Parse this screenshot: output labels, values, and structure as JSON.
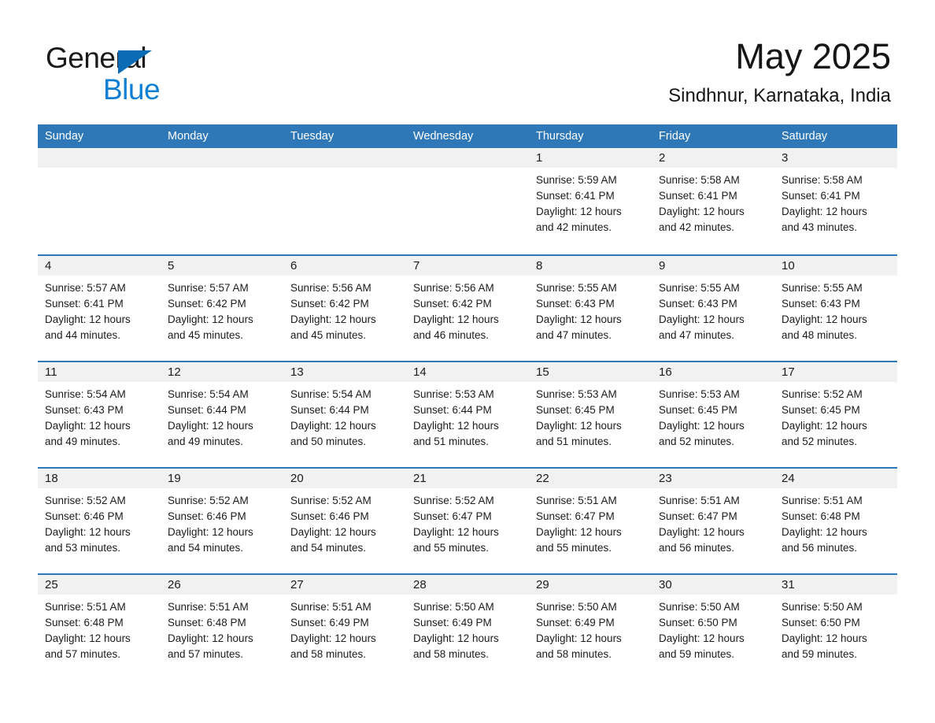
{
  "brand": {
    "name_part1": "General",
    "name_part2": "Blue",
    "triangle_icon": "triangle-icon",
    "accent_dark": "#0a6cb5",
    "accent_light": "#0f7fd4"
  },
  "header": {
    "month_title": "May 2025",
    "location": "Sindhnur, Karnataka, India"
  },
  "calendar": {
    "header_color": "#2f78b8",
    "day_band_color": "#f1f1f1",
    "weekdays": [
      "Sunday",
      "Monday",
      "Tuesday",
      "Wednesday",
      "Thursday",
      "Friday",
      "Saturday"
    ],
    "weeks": [
      [
        {
          "day": "",
          "empty": true,
          "sunrise": "",
          "sunset": "",
          "daylight_line1": "",
          "daylight_line2": ""
        },
        {
          "day": "",
          "empty": true,
          "sunrise": "",
          "sunset": "",
          "daylight_line1": "",
          "daylight_line2": ""
        },
        {
          "day": "",
          "empty": true,
          "sunrise": "",
          "sunset": "",
          "daylight_line1": "",
          "daylight_line2": ""
        },
        {
          "day": "",
          "empty": true,
          "sunrise": "",
          "sunset": "",
          "daylight_line1": "",
          "daylight_line2": ""
        },
        {
          "day": "1",
          "empty": false,
          "sunrise": "Sunrise: 5:59 AM",
          "sunset": "Sunset: 6:41 PM",
          "daylight_line1": "Daylight: 12 hours",
          "daylight_line2": "and 42 minutes."
        },
        {
          "day": "2",
          "empty": false,
          "sunrise": "Sunrise: 5:58 AM",
          "sunset": "Sunset: 6:41 PM",
          "daylight_line1": "Daylight: 12 hours",
          "daylight_line2": "and 42 minutes."
        },
        {
          "day": "3",
          "empty": false,
          "sunrise": "Sunrise: 5:58 AM",
          "sunset": "Sunset: 6:41 PM",
          "daylight_line1": "Daylight: 12 hours",
          "daylight_line2": "and 43 minutes."
        }
      ],
      [
        {
          "day": "4",
          "empty": false,
          "sunrise": "Sunrise: 5:57 AM",
          "sunset": "Sunset: 6:41 PM",
          "daylight_line1": "Daylight: 12 hours",
          "daylight_line2": "and 44 minutes."
        },
        {
          "day": "5",
          "empty": false,
          "sunrise": "Sunrise: 5:57 AM",
          "sunset": "Sunset: 6:42 PM",
          "daylight_line1": "Daylight: 12 hours",
          "daylight_line2": "and 45 minutes."
        },
        {
          "day": "6",
          "empty": false,
          "sunrise": "Sunrise: 5:56 AM",
          "sunset": "Sunset: 6:42 PM",
          "daylight_line1": "Daylight: 12 hours",
          "daylight_line2": "and 45 minutes."
        },
        {
          "day": "7",
          "empty": false,
          "sunrise": "Sunrise: 5:56 AM",
          "sunset": "Sunset: 6:42 PM",
          "daylight_line1": "Daylight: 12 hours",
          "daylight_line2": "and 46 minutes."
        },
        {
          "day": "8",
          "empty": false,
          "sunrise": "Sunrise: 5:55 AM",
          "sunset": "Sunset: 6:43 PM",
          "daylight_line1": "Daylight: 12 hours",
          "daylight_line2": "and 47 minutes."
        },
        {
          "day": "9",
          "empty": false,
          "sunrise": "Sunrise: 5:55 AM",
          "sunset": "Sunset: 6:43 PM",
          "daylight_line1": "Daylight: 12 hours",
          "daylight_line2": "and 47 minutes."
        },
        {
          "day": "10",
          "empty": false,
          "sunrise": "Sunrise: 5:55 AM",
          "sunset": "Sunset: 6:43 PM",
          "daylight_line1": "Daylight: 12 hours",
          "daylight_line2": "and 48 minutes."
        }
      ],
      [
        {
          "day": "11",
          "empty": false,
          "sunrise": "Sunrise: 5:54 AM",
          "sunset": "Sunset: 6:43 PM",
          "daylight_line1": "Daylight: 12 hours",
          "daylight_line2": "and 49 minutes."
        },
        {
          "day": "12",
          "empty": false,
          "sunrise": "Sunrise: 5:54 AM",
          "sunset": "Sunset: 6:44 PM",
          "daylight_line1": "Daylight: 12 hours",
          "daylight_line2": "and 49 minutes."
        },
        {
          "day": "13",
          "empty": false,
          "sunrise": "Sunrise: 5:54 AM",
          "sunset": "Sunset: 6:44 PM",
          "daylight_line1": "Daylight: 12 hours",
          "daylight_line2": "and 50 minutes."
        },
        {
          "day": "14",
          "empty": false,
          "sunrise": "Sunrise: 5:53 AM",
          "sunset": "Sunset: 6:44 PM",
          "daylight_line1": "Daylight: 12 hours",
          "daylight_line2": "and 51 minutes."
        },
        {
          "day": "15",
          "empty": false,
          "sunrise": "Sunrise: 5:53 AM",
          "sunset": "Sunset: 6:45 PM",
          "daylight_line1": "Daylight: 12 hours",
          "daylight_line2": "and 51 minutes."
        },
        {
          "day": "16",
          "empty": false,
          "sunrise": "Sunrise: 5:53 AM",
          "sunset": "Sunset: 6:45 PM",
          "daylight_line1": "Daylight: 12 hours",
          "daylight_line2": "and 52 minutes."
        },
        {
          "day": "17",
          "empty": false,
          "sunrise": "Sunrise: 5:52 AM",
          "sunset": "Sunset: 6:45 PM",
          "daylight_line1": "Daylight: 12 hours",
          "daylight_line2": "and 52 minutes."
        }
      ],
      [
        {
          "day": "18",
          "empty": false,
          "sunrise": "Sunrise: 5:52 AM",
          "sunset": "Sunset: 6:46 PM",
          "daylight_line1": "Daylight: 12 hours",
          "daylight_line2": "and 53 minutes."
        },
        {
          "day": "19",
          "empty": false,
          "sunrise": "Sunrise: 5:52 AM",
          "sunset": "Sunset: 6:46 PM",
          "daylight_line1": "Daylight: 12 hours",
          "daylight_line2": "and 54 minutes."
        },
        {
          "day": "20",
          "empty": false,
          "sunrise": "Sunrise: 5:52 AM",
          "sunset": "Sunset: 6:46 PM",
          "daylight_line1": "Daylight: 12 hours",
          "daylight_line2": "and 54 minutes."
        },
        {
          "day": "21",
          "empty": false,
          "sunrise": "Sunrise: 5:52 AM",
          "sunset": "Sunset: 6:47 PM",
          "daylight_line1": "Daylight: 12 hours",
          "daylight_line2": "and 55 minutes."
        },
        {
          "day": "22",
          "empty": false,
          "sunrise": "Sunrise: 5:51 AM",
          "sunset": "Sunset: 6:47 PM",
          "daylight_line1": "Daylight: 12 hours",
          "daylight_line2": "and 55 minutes."
        },
        {
          "day": "23",
          "empty": false,
          "sunrise": "Sunrise: 5:51 AM",
          "sunset": "Sunset: 6:47 PM",
          "daylight_line1": "Daylight: 12 hours",
          "daylight_line2": "and 56 minutes."
        },
        {
          "day": "24",
          "empty": false,
          "sunrise": "Sunrise: 5:51 AM",
          "sunset": "Sunset: 6:48 PM",
          "daylight_line1": "Daylight: 12 hours",
          "daylight_line2": "and 56 minutes."
        }
      ],
      [
        {
          "day": "25",
          "empty": false,
          "sunrise": "Sunrise: 5:51 AM",
          "sunset": "Sunset: 6:48 PM",
          "daylight_line1": "Daylight: 12 hours",
          "daylight_line2": "and 57 minutes."
        },
        {
          "day": "26",
          "empty": false,
          "sunrise": "Sunrise: 5:51 AM",
          "sunset": "Sunset: 6:48 PM",
          "daylight_line1": "Daylight: 12 hours",
          "daylight_line2": "and 57 minutes."
        },
        {
          "day": "27",
          "empty": false,
          "sunrise": "Sunrise: 5:51 AM",
          "sunset": "Sunset: 6:49 PM",
          "daylight_line1": "Daylight: 12 hours",
          "daylight_line2": "and 58 minutes."
        },
        {
          "day": "28",
          "empty": false,
          "sunrise": "Sunrise: 5:50 AM",
          "sunset": "Sunset: 6:49 PM",
          "daylight_line1": "Daylight: 12 hours",
          "daylight_line2": "and 58 minutes."
        },
        {
          "day": "29",
          "empty": false,
          "sunrise": "Sunrise: 5:50 AM",
          "sunset": "Sunset: 6:49 PM",
          "daylight_line1": "Daylight: 12 hours",
          "daylight_line2": "and 58 minutes."
        },
        {
          "day": "30",
          "empty": false,
          "sunrise": "Sunrise: 5:50 AM",
          "sunset": "Sunset: 6:50 PM",
          "daylight_line1": "Daylight: 12 hours",
          "daylight_line2": "and 59 minutes."
        },
        {
          "day": "31",
          "empty": false,
          "sunrise": "Sunrise: 5:50 AM",
          "sunset": "Sunset: 6:50 PM",
          "daylight_line1": "Daylight: 12 hours",
          "daylight_line2": "and 59 minutes."
        }
      ]
    ]
  }
}
